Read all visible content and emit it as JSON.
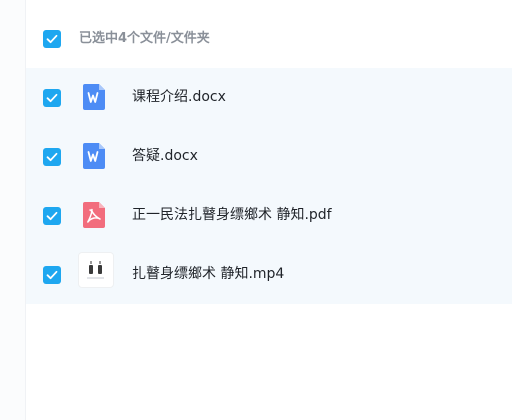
{
  "header": {
    "selected_label": "已选中4个文件/文件夹"
  },
  "files": [
    {
      "name": "课程介绍.docx",
      "icon": "word-doc-icon",
      "color": "#4d8cf5"
    },
    {
      "name": "答疑.docx",
      "icon": "word-doc-icon",
      "color": "#4d8cf5"
    },
    {
      "name": "正一民法扎瞽身缥鄉术 静知.pdf",
      "icon": "pdf-icon",
      "color": "#f26d7d"
    },
    {
      "name": "扎瞽身缥鄉术 静知.mp4",
      "icon": "video-thumbnail-icon",
      "color": "#3a3a3a"
    }
  ],
  "colors": {
    "accent": "#1ea7f0",
    "list_bg": "#f4f9fd"
  }
}
